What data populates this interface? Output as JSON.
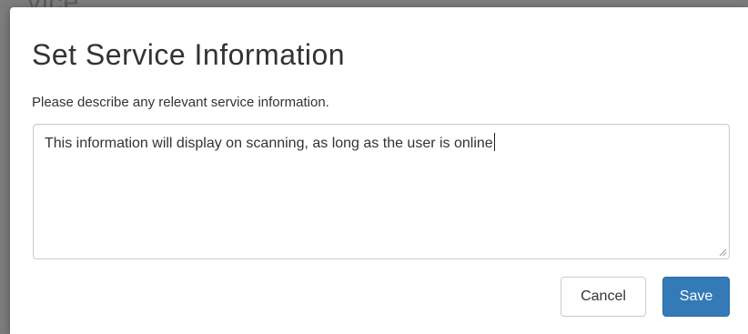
{
  "backdrop": {
    "fragment_text": "vice"
  },
  "modal": {
    "title": "Set Service Information",
    "description": "Please describe any relevant service information.",
    "textarea": {
      "value": "This information will display on scanning, as long as the user is online"
    },
    "buttons": {
      "cancel_label": "Cancel",
      "save_label": "Save"
    }
  },
  "colors": {
    "primary": "#337ab7",
    "primary_border": "#2e6da4",
    "backdrop": "#7d7d7d",
    "text": "#333333",
    "border": "#cccccc"
  }
}
